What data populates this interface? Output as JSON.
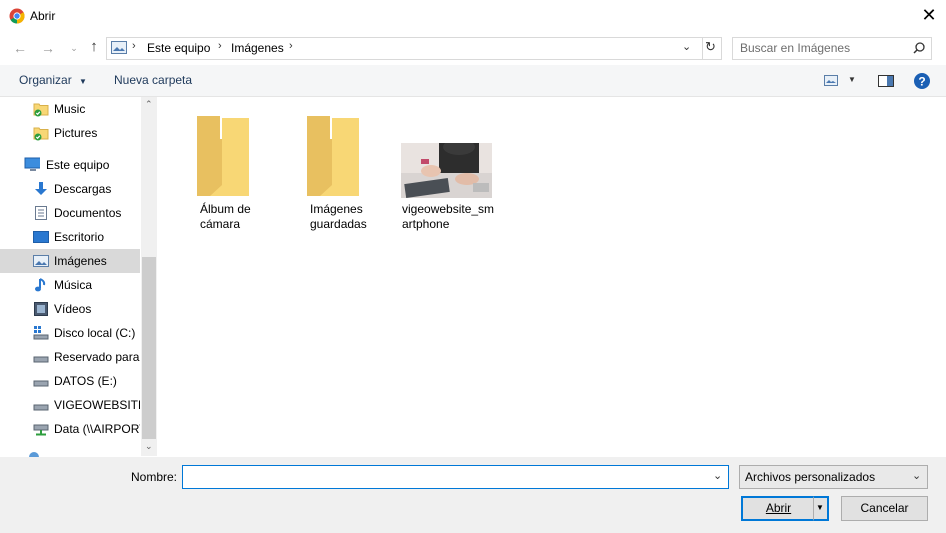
{
  "window": {
    "title": "Abrir",
    "close_label": "✕"
  },
  "nav": {
    "breadcrumb": [
      "Este equipo",
      "Imágenes"
    ],
    "search_placeholder": "Buscar en Imágenes"
  },
  "toolbar": {
    "organize_label": "Organizar",
    "new_folder_label": "Nueva carpeta"
  },
  "sidebar": {
    "items": [
      {
        "label": "Music"
      },
      {
        "label": "Pictures"
      },
      {
        "label": "Este equipo"
      },
      {
        "label": "Descargas"
      },
      {
        "label": "Documentos"
      },
      {
        "label": "Escritorio"
      },
      {
        "label": "Imágenes"
      },
      {
        "label": "Música"
      },
      {
        "label": "Vídeos"
      },
      {
        "label": "Disco local (C:)"
      },
      {
        "label": "Reservado para el sistema"
      },
      {
        "label": "DATOS (E:)"
      },
      {
        "label": "VIGEOWEBSITE (F:)"
      },
      {
        "label": "Data (\\\\AIRPORT)"
      }
    ],
    "selected": "Imágenes"
  },
  "files": [
    {
      "line1": "Álbum de",
      "line2": "cámara",
      "type": "folder"
    },
    {
      "line1": "Imágenes",
      "line2": "guardadas",
      "type": "folder"
    },
    {
      "line1": "vigeowebsite_sm",
      "line2": "artphone",
      "type": "image"
    }
  ],
  "footer": {
    "name_label": "Nombre:",
    "name_value": "",
    "filetype_value": "Archivos personalizados",
    "open_label": "Abrir",
    "cancel_label": "Cancelar"
  },
  "colors": {
    "accent": "#0078d7",
    "folder": "#f8d775",
    "help": "#1a5fb4"
  }
}
